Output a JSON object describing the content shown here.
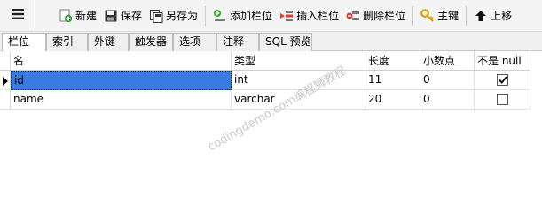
{
  "toolbar": {
    "new_label": "新建",
    "save_label": "保存",
    "save_as_label": "另存为",
    "add_field_label": "添加栏位",
    "insert_field_label": "插入栏位",
    "delete_field_label": "删除栏位",
    "primary_key_label": "主键",
    "move_up_label": "上移"
  },
  "tabs": [
    "栏位",
    "索引",
    "外键",
    "触发器",
    "选项",
    "注释",
    "SQL 预览"
  ],
  "columns": {
    "name": "名",
    "type": "类型",
    "length": "长度",
    "decimals": "小数点",
    "not_null": "不是 null"
  },
  "rows": [
    {
      "name": "id",
      "type": "int",
      "length": "11",
      "decimals": "0",
      "not_null": true
    },
    {
      "name": "name",
      "type": "varchar",
      "length": "20",
      "decimals": "0",
      "not_null": false
    }
  ],
  "watermark": "codingdemo.com编程狮教程",
  "colors": {
    "selection": "#3a7be0",
    "toolbar_bg": "#f4f4f4"
  }
}
